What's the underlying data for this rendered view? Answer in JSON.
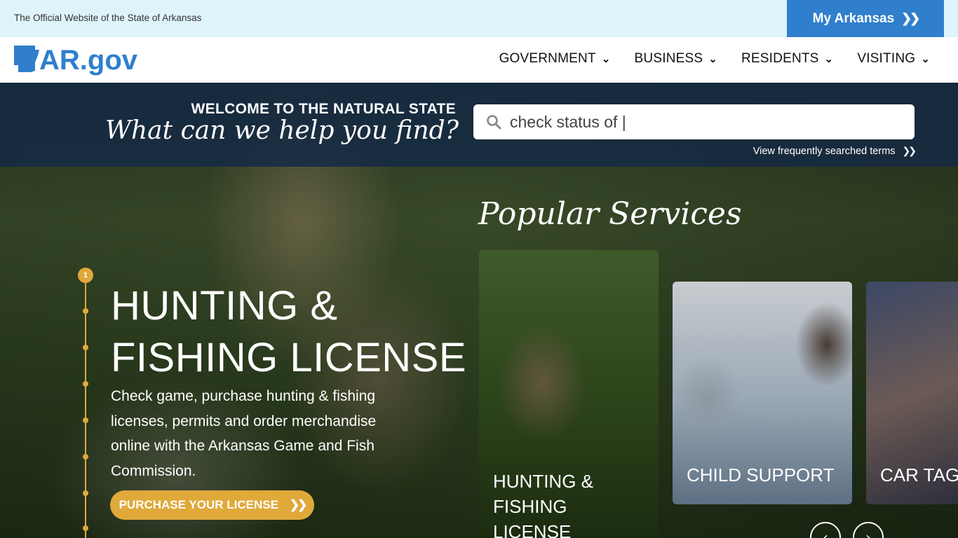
{
  "topbar": {
    "official_text": "The Official Website of the State of Arkansas",
    "my_arkansas_label": "My Arkansas"
  },
  "header": {
    "logo_text": "AR.gov",
    "nav": [
      {
        "label": "GOVERNMENT"
      },
      {
        "label": "BUSINESS"
      },
      {
        "label": "RESIDENTS"
      },
      {
        "label": "VISITING"
      }
    ]
  },
  "search": {
    "welcome": "WELCOME TO THE NATURAL STATE",
    "headline": "What can we help you find?",
    "value": "check status of |",
    "frequent_link": "View frequently searched terms"
  },
  "feature": {
    "step": "1",
    "title_line1": "HUNTING &",
    "title_line2": "FISHING LICENSE",
    "description": "Check game, purchase hunting & fishing licenses, permits and order merchandise online with the Arkansas Game and Fish Commission.",
    "cta_label": "PURCHASE YOUR LICENSE"
  },
  "popular": {
    "heading": "Popular Services",
    "cards": [
      {
        "label_line1": "HUNTING & FISHING",
        "label_line2": "LICENSE"
      },
      {
        "label_line1": "CHILD SUPPORT"
      },
      {
        "label_line1": "CAR TAG R"
      }
    ]
  },
  "icons": {
    "search": "search-icon",
    "chevrons": "double-chevron-right-icon",
    "nav_chevron": "double-chevron-down-icon",
    "prev": "chevron-left-icon",
    "next": "chevron-right-icon"
  },
  "colors": {
    "accent_blue": "#2f7fcc",
    "topbar_bg": "#dff3fb",
    "gold": "#e0a93a",
    "navy": "#1b2e4e"
  }
}
